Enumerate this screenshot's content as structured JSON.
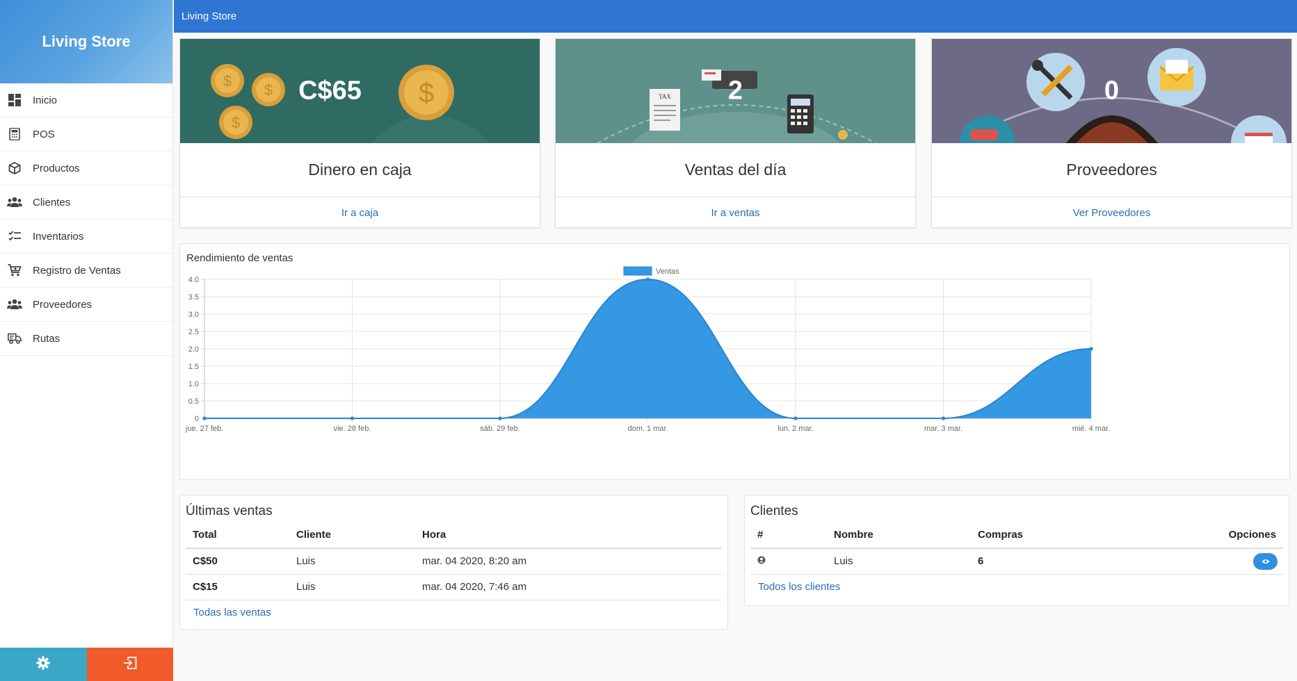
{
  "app": {
    "name": "Living Store",
    "topbar_title": "Living Store"
  },
  "sidebar": {
    "items": [
      {
        "label": "Inicio",
        "icon": "dashboard-icon"
      },
      {
        "label": "POS",
        "icon": "calculator-icon"
      },
      {
        "label": "Productos",
        "icon": "cube-icon"
      },
      {
        "label": "Clientes",
        "icon": "users-icon"
      },
      {
        "label": "Inventarios",
        "icon": "checklist-icon"
      },
      {
        "label": "Registro de Ventas",
        "icon": "cart-icon"
      },
      {
        "label": "Proveedores",
        "icon": "users-icon"
      },
      {
        "label": "Rutas",
        "icon": "truck-icon"
      }
    ],
    "footer": {
      "settings_icon": "gear-icon",
      "logout_icon": "logout-icon"
    }
  },
  "cards": [
    {
      "value": "C$65",
      "title": "Dinero en caja",
      "link": "Ir a caja",
      "bg": "#2f6b63"
    },
    {
      "value": "2",
      "title": "Ventas del día",
      "link": "Ir a ventas",
      "bg": "#5f918a"
    },
    {
      "value": "0",
      "title": "Proveedores",
      "link": "Ver Proveedores",
      "bg": "#6d6a86"
    }
  ],
  "chart_panel": {
    "title": "Rendimiento de ventas"
  },
  "chart_data": {
    "type": "area",
    "title": "",
    "x": [
      "jue. 27 feb.",
      "vie. 28 feb.",
      "sáb. 29 feb.",
      "dom. 1 mar.",
      "lun. 2 mar.",
      "mar. 3 mar.",
      "mié. 4 mar."
    ],
    "series": [
      {
        "name": "Ventas",
        "values": [
          0,
          0,
          0,
          4,
          0,
          0,
          2
        ],
        "color": "#3498e2"
      }
    ],
    "ylim": [
      0,
      4
    ],
    "yticks": [
      "0",
      "0.5",
      "1.0",
      "1.5",
      "2.0",
      "2.5",
      "3.0",
      "3.5",
      "4.0"
    ],
    "grid": true,
    "legend": "top-center",
    "xlabel": "",
    "ylabel": ""
  },
  "sales": {
    "title": "Últimas ventas",
    "headers": {
      "total": "Total",
      "client": "Cliente",
      "time": "Hora"
    },
    "rows": [
      {
        "total": "C$50",
        "client": "Luis",
        "time": "mar. 04 2020, 8:20 am"
      },
      {
        "total": "C$15",
        "client": "Luis",
        "time": "mar. 04 2020, 7:46 am"
      }
    ],
    "link": "Todas las ventas"
  },
  "clients": {
    "title": "Clientes",
    "headers": {
      "num": "#",
      "name": "Nombre",
      "purchases": "Compras",
      "options": "Opciones"
    },
    "rows": [
      {
        "icon": "user-circle-icon",
        "name": "Luis",
        "purchases": "6"
      }
    ],
    "link": "Todos los clientes"
  }
}
